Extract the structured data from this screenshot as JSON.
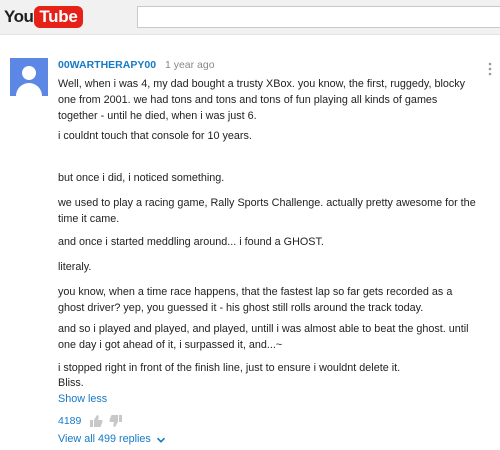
{
  "header": {
    "logo_you": "You",
    "logo_tube": "Tube",
    "search_placeholder": ""
  },
  "comment": {
    "author": "00WARTHERAPY00",
    "time": "1 year ago",
    "paragraphs": [
      "Well, when i was 4, my dad bought a trusty XBox. you know, the first, ruggedy, blocky one from 2001. we had tons and tons and tons of fun playing all kinds of games together - until he died, when i was just 6.",
      "i couldnt touch that console for 10 years.",
      "but once i did, i noticed something.",
      "we used to play a racing game, Rally Sports Challenge. actually pretty awesome for the time it came.",
      "and once i started meddling around... i found a GHOST.",
      "literaly.",
      "you know, when a time race happens, that the fastest lap so far gets recorded as a ghost driver? yep, you guessed it - his ghost still rolls around the track today.",
      "and so i played and played, and played, untill i was almost able to beat the ghost. until one day i got ahead of it, i surpassed it, and...~",
      "i stopped right in front of the finish line, just to ensure i wouldnt delete it.",
      "Bliss."
    ],
    "show_less": "Show less",
    "like_count": "4189",
    "view_all": "View all 499 replies",
    "colors": {
      "link": "#167ac6",
      "avatar_bg": "#5c87e4",
      "logo_red": "#e62117"
    },
    "icons": [
      "thumb-up-icon",
      "thumb-down-icon",
      "chevron-down-icon",
      "more-vert-icon",
      "avatar-icon"
    ]
  }
}
